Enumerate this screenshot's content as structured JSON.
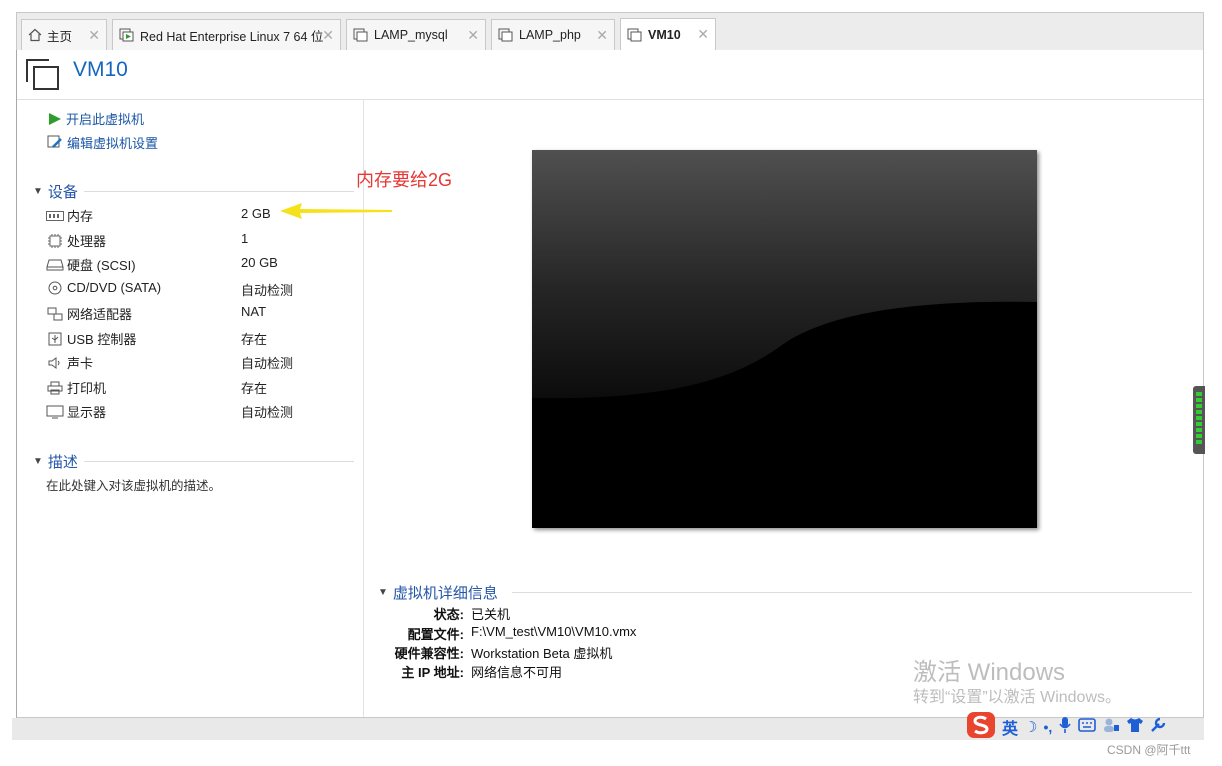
{
  "tabs": [
    {
      "label": "主页",
      "icon": "home-icon"
    },
    {
      "label": "Red Hat Enterprise Linux 7 64 位",
      "icon": "vm-running-icon"
    },
    {
      "label": "LAMP_mysql",
      "icon": "vm-icon"
    },
    {
      "label": "LAMP_php",
      "icon": "vm-icon"
    },
    {
      "label": "VM10",
      "icon": "vm-icon",
      "active": true
    }
  ],
  "vm": {
    "name": "VM10"
  },
  "actions": {
    "power_on": "开启此虚拟机",
    "edit_settings": "编辑虚拟机设置"
  },
  "devices": {
    "heading": "设备",
    "items": [
      {
        "name": "内存",
        "value": "2 GB",
        "icon": "memory-icon"
      },
      {
        "name": "处理器",
        "value": "1",
        "icon": "cpu-icon"
      },
      {
        "name": "硬盘 (SCSI)",
        "value": "20 GB",
        "icon": "hard-disk-icon"
      },
      {
        "name": "CD/DVD (SATA)",
        "value": "自动检测",
        "icon": "cd-dvd-icon"
      },
      {
        "name": "网络适配器",
        "value": "NAT",
        "icon": "network-adapter-icon"
      },
      {
        "name": "USB 控制器",
        "value": "存在",
        "icon": "usb-icon"
      },
      {
        "name": "声卡",
        "value": "自动检测",
        "icon": "sound-card-icon"
      },
      {
        "name": "打印机",
        "value": "存在",
        "icon": "printer-icon"
      },
      {
        "name": "显示器",
        "value": "自动检测",
        "icon": "display-icon"
      }
    ]
  },
  "description": {
    "heading": "描述",
    "placeholder": "在此处键入对该虚拟机的描述。"
  },
  "details": {
    "heading": "虚拟机详细信息",
    "rows": [
      {
        "label": "状态:",
        "value": "已关机"
      },
      {
        "label": "配置文件:",
        "value": "F:\\VM_test\\VM10\\VM10.vmx"
      },
      {
        "label": "硬件兼容性:",
        "value": "Workstation Beta 虚拟机"
      },
      {
        "label": "主 IP 地址:",
        "value": "网络信息不可用"
      }
    ]
  },
  "annotation": {
    "text": "内存要给2G",
    "color": "#e53935"
  },
  "watermark": {
    "line1": "激活 Windows",
    "line2": "转到“设置”以激活 Windows。"
  },
  "ime": {
    "lang": "英"
  },
  "csdn": {
    "text": "CSDN @阿千ttt"
  },
  "colors": {
    "accent": "#1565c0",
    "play": "#2e9d2e",
    "annotation_arrow": "#f5e21b"
  }
}
